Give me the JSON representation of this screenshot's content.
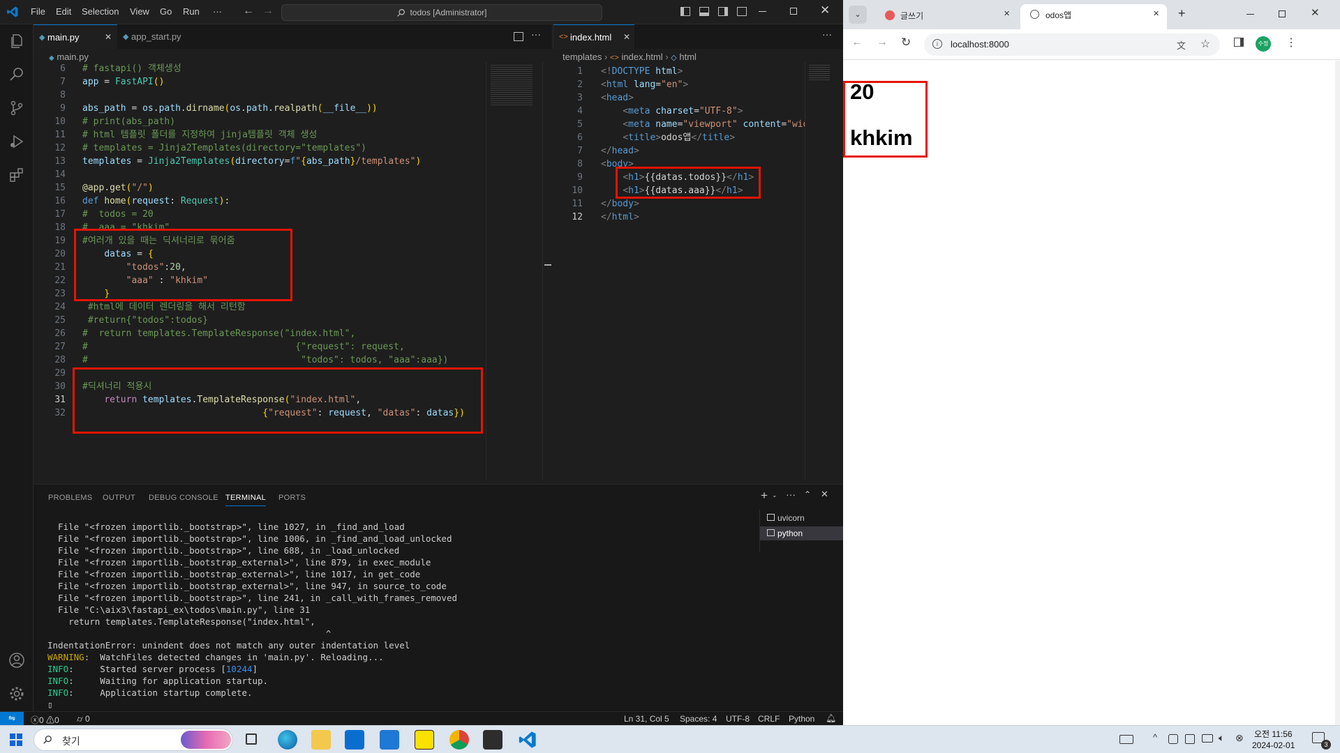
{
  "vscode": {
    "menu": [
      "File",
      "Edit",
      "Selection",
      "View",
      "Go",
      "Run",
      "···"
    ],
    "search": "todos [Administrator]",
    "left_tabs": [
      {
        "label": "main.py",
        "active": true
      },
      {
        "label": "app_start.py",
        "active": false
      }
    ],
    "left_breadcrumb": "main.py",
    "right_tabs": [
      {
        "label": "index.html",
        "active": true
      }
    ],
    "right_breadcrumb": [
      "templates",
      "index.html",
      "html"
    ],
    "left_line_numbers": [
      "6",
      "7",
      "8",
      "9",
      "10",
      "11",
      "12",
      "13",
      "14",
      "15",
      "16",
      "17",
      "18",
      "19",
      "20",
      "21",
      "22",
      "23",
      "24",
      "25",
      "26",
      "27",
      "28",
      "29",
      "30",
      "31",
      "32"
    ],
    "left_code": [
      [
        [
          "cm",
          "# fastapi() 객체생성"
        ]
      ],
      [
        [
          "va",
          "app"
        ],
        [
          "pl",
          " = "
        ],
        [
          "cl",
          "FastAPI"
        ],
        [
          "br",
          "()"
        ]
      ],
      [
        [
          "pl",
          ""
        ]
      ],
      [
        [
          "va",
          "abs_path"
        ],
        [
          "pl",
          " = "
        ],
        [
          "va",
          "os"
        ],
        [
          "pl",
          "."
        ],
        [
          "va",
          "path"
        ],
        [
          "pl",
          "."
        ],
        [
          "fn",
          "dirname"
        ],
        [
          "br",
          "("
        ],
        [
          "va",
          "os"
        ],
        [
          "pl",
          "."
        ],
        [
          "va",
          "path"
        ],
        [
          "pl",
          "."
        ],
        [
          "fn",
          "realpath"
        ],
        [
          "br",
          "("
        ],
        [
          "va",
          "__file__"
        ],
        [
          "br",
          "))"
        ]
      ],
      [
        [
          "cm",
          "# print(abs_path)"
        ]
      ],
      [
        [
          "cm",
          "# html 템플릿 폴더를 지정하여 jinja템플릿 객체 생성"
        ]
      ],
      [
        [
          "cm",
          "# templates = Jinja2Templates(directory=\"templates\")"
        ]
      ],
      [
        [
          "va",
          "templates"
        ],
        [
          "pl",
          " = "
        ],
        [
          "cl",
          "Jinja2Templates"
        ],
        [
          "br",
          "("
        ],
        [
          "va",
          "directory"
        ],
        [
          "pl",
          "="
        ],
        [
          "kw",
          "f"
        ],
        [
          "st",
          "\""
        ],
        [
          "br",
          "{"
        ],
        [
          "va",
          "abs_path"
        ],
        [
          "br",
          "}"
        ],
        [
          "st",
          "/templates\""
        ],
        [
          "br",
          ")"
        ]
      ],
      [
        [
          "pl",
          ""
        ]
      ],
      [
        [
          "fn",
          "@app"
        ],
        [
          "pl",
          "."
        ],
        [
          "fn",
          "get"
        ],
        [
          "br",
          "("
        ],
        [
          "st",
          "\"/\""
        ],
        [
          "br",
          ")"
        ]
      ],
      [
        [
          "kw",
          "def "
        ],
        [
          "fn",
          "home"
        ],
        [
          "br",
          "("
        ],
        [
          "va",
          "request"
        ],
        [
          "pl",
          ": "
        ],
        [
          "cl",
          "Request"
        ],
        [
          "br",
          ")"
        ],
        [
          "pl",
          ":"
        ]
      ],
      [
        [
          "cm",
          "#  todos = 20"
        ]
      ],
      [
        [
          "cm",
          "#  aaa = \"khkim\""
        ]
      ],
      [
        [
          "cm",
          "#여러개 있을 때는 딕셔너리로 묶어줌"
        ]
      ],
      [
        [
          "pl",
          "    "
        ],
        [
          "va",
          "datas"
        ],
        [
          "pl",
          " = "
        ],
        [
          "br",
          "{"
        ]
      ],
      [
        [
          "pl",
          "        "
        ],
        [
          "st",
          "\"todos\""
        ],
        [
          "pl",
          ":"
        ],
        [
          "nm",
          "20"
        ],
        [
          "pl",
          ","
        ]
      ],
      [
        [
          "pl",
          "        "
        ],
        [
          "st",
          "\"aaa\""
        ],
        [
          "pl",
          " : "
        ],
        [
          "st",
          "\"khkim\""
        ]
      ],
      [
        [
          "pl",
          "    "
        ],
        [
          "br",
          "}"
        ]
      ],
      [
        [
          "cm",
          " #html에 데이터 렌더링을 해서 리턴함"
        ]
      ],
      [
        [
          "cm",
          " #return{\"todos\":todos}"
        ]
      ],
      [
        [
          "cm",
          "#  return templates.TemplateResponse(\"index.html\","
        ]
      ],
      [
        [
          "cm",
          "#                                      {\"request\": request,"
        ]
      ],
      [
        [
          "cm",
          "#                                       \"todos\": todos, \"aaa\":aaa})"
        ]
      ],
      [
        [
          "pl",
          ""
        ]
      ],
      [
        [
          "cm",
          "#딕셔너리 적용시"
        ]
      ],
      [
        [
          "pl",
          "    "
        ],
        [
          "kw2",
          "return "
        ],
        [
          "va",
          "templates"
        ],
        [
          "pl",
          "."
        ],
        [
          "fn",
          "TemplateResponse"
        ],
        [
          "br",
          "("
        ],
        [
          "st",
          "\"index.html\""
        ],
        [
          "pl",
          ","
        ]
      ],
      [
        [
          "pl",
          "                                 "
        ],
        [
          "br",
          "{"
        ],
        [
          "st",
          "\"request\""
        ],
        [
          "pl",
          ": "
        ],
        [
          "va",
          "request"
        ],
        [
          "pl",
          ", "
        ],
        [
          "st",
          "\"datas\""
        ],
        [
          "pl",
          ": "
        ],
        [
          "va",
          "datas"
        ],
        [
          "br",
          "})"
        ]
      ]
    ],
    "right_line_numbers": [
      "1",
      "2",
      "3",
      "4",
      "5",
      "6",
      "7",
      "8",
      "9",
      "10",
      "11",
      "12"
    ],
    "right_code": [
      [
        [
          "gy",
          "<!"
        ],
        [
          "tg",
          "DOCTYPE "
        ],
        [
          "at",
          "html"
        ],
        [
          "gy",
          ">"
        ]
      ],
      [
        [
          "gy",
          "<"
        ],
        [
          "tg",
          "html "
        ],
        [
          "at",
          "lang"
        ],
        [
          "pl",
          "="
        ],
        [
          "st",
          "\"en\""
        ],
        [
          "gy",
          ">"
        ]
      ],
      [
        [
          "gy",
          "<"
        ],
        [
          "tg",
          "head"
        ],
        [
          "gy",
          ">"
        ]
      ],
      [
        [
          "pl",
          "    "
        ],
        [
          "gy",
          "<"
        ],
        [
          "tg",
          "meta "
        ],
        [
          "at",
          "charset"
        ],
        [
          "pl",
          "="
        ],
        [
          "st",
          "\"UTF-8\""
        ],
        [
          "gy",
          ">"
        ]
      ],
      [
        [
          "pl",
          "    "
        ],
        [
          "gy",
          "<"
        ],
        [
          "tg",
          "meta "
        ],
        [
          "at",
          "name"
        ],
        [
          "pl",
          "="
        ],
        [
          "st",
          "\"viewport\""
        ],
        [
          "pl",
          " "
        ],
        [
          "at",
          "content"
        ],
        [
          "pl",
          "="
        ],
        [
          "st",
          "\"wid"
        ]
      ],
      [
        [
          "pl",
          "    "
        ],
        [
          "gy",
          "<"
        ],
        [
          "tg",
          "title"
        ],
        [
          "gy",
          ">"
        ],
        [
          "pl",
          "odos앱"
        ],
        [
          "gy",
          "</"
        ],
        [
          "tg",
          "title"
        ],
        [
          "gy",
          ">"
        ]
      ],
      [
        [
          "gy",
          "</"
        ],
        [
          "tg",
          "head"
        ],
        [
          "gy",
          ">"
        ]
      ],
      [
        [
          "gy",
          "<"
        ],
        [
          "tg",
          "body"
        ],
        [
          "gy",
          ">"
        ]
      ],
      [
        [
          "pl",
          "    "
        ],
        [
          "gy",
          "<"
        ],
        [
          "tg",
          "h1"
        ],
        [
          "gy",
          ">"
        ],
        [
          "pl",
          "{{datas.todos}}"
        ],
        [
          "gy",
          "</"
        ],
        [
          "tg",
          "h1"
        ],
        [
          "gy",
          ">"
        ]
      ],
      [
        [
          "pl",
          "    "
        ],
        [
          "gy",
          "<"
        ],
        [
          "tg",
          "h1"
        ],
        [
          "gy",
          ">"
        ],
        [
          "pl",
          "{{datas.aaa}}"
        ],
        [
          "gy",
          "</"
        ],
        [
          "tg",
          "h1"
        ],
        [
          "gy",
          ">"
        ]
      ],
      [
        [
          "gy",
          "</"
        ],
        [
          "tg",
          "body"
        ],
        [
          "gy",
          ">"
        ]
      ],
      [
        [
          "gy",
          "</"
        ],
        [
          "tg",
          "html"
        ],
        [
          "gy",
          ">"
        ]
      ]
    ],
    "panel_tabs": [
      "PROBLEMS",
      "OUTPUT",
      "DEBUG CONSOLE",
      "TERMINAL",
      "PORTS"
    ],
    "terminal_lines": [
      [
        [
          "pl",
          "  File \"<frozen importlib._bootstrap>\", line 1027, in _find_and_load"
        ]
      ],
      [
        [
          "pl",
          "  File \"<frozen importlib._bootstrap>\", line 1006, in _find_and_load_unlocked"
        ]
      ],
      [
        [
          "pl",
          "  File \"<frozen importlib._bootstrap>\", line 688, in _load_unlocked"
        ]
      ],
      [
        [
          "pl",
          "  File \"<frozen importlib._bootstrap_external>\", line 879, in exec_module"
        ]
      ],
      [
        [
          "pl",
          "  File \"<frozen importlib._bootstrap_external>\", line 1017, in get_code"
        ]
      ],
      [
        [
          "pl",
          "  File \"<frozen importlib._bootstrap_external>\", line 947, in source_to_code"
        ]
      ],
      [
        [
          "pl",
          "  File \"<frozen importlib._bootstrap>\", line 241, in _call_with_frames_removed"
        ]
      ],
      [
        [
          "pl",
          "  File \"C:\\aix3\\fastapi_ex\\todos\\main.py\", line 31"
        ]
      ],
      [
        [
          "pl",
          "    return templates.TemplateResponse(\"index.html\","
        ]
      ],
      [
        [
          "pl",
          "                                                     ^"
        ]
      ],
      [
        [
          "pl",
          "IndentationError: unindent does not match any outer indentation level"
        ]
      ],
      [
        [
          "yl",
          "WARNING"
        ],
        [
          "pl",
          ":  WatchFiles detected changes in 'main.py'. Reloading..."
        ]
      ],
      [
        [
          "gn",
          "INFO"
        ],
        [
          "pl",
          ":     Started server process ["
        ],
        [
          "bl",
          "10244"
        ],
        [
          "pl",
          "]"
        ]
      ],
      [
        [
          "gn",
          "INFO"
        ],
        [
          "pl",
          ":     Waiting for application startup."
        ]
      ],
      [
        [
          "gn",
          "INFO"
        ],
        [
          "pl",
          ":     Application startup complete."
        ]
      ],
      [
        [
          "pl",
          "▯"
        ]
      ]
    ],
    "terminals": [
      {
        "label": "uvicorn",
        "active": false
      },
      {
        "label": "python",
        "active": true
      }
    ],
    "status": {
      "errors": "0",
      "warnings": "0",
      "ports": "0",
      "position": "Ln 31, Col 5",
      "spaces": "Spaces: 4",
      "encoding": "UTF-8",
      "eol": "CRLF",
      "language": "Python"
    }
  },
  "browser": {
    "tabs": [
      {
        "label": "글쓰기",
        "active": false
      },
      {
        "label": "odos앱",
        "active": true
      }
    ],
    "url": "localhost:8000",
    "profile_initials": "수정",
    "page_h1_1": "20",
    "page_h1_2": "khkim"
  },
  "taskbar": {
    "search_placeholder": "찾기",
    "time": "오전 11:56",
    "date": "2024-02-01",
    "notification_count": "3"
  }
}
